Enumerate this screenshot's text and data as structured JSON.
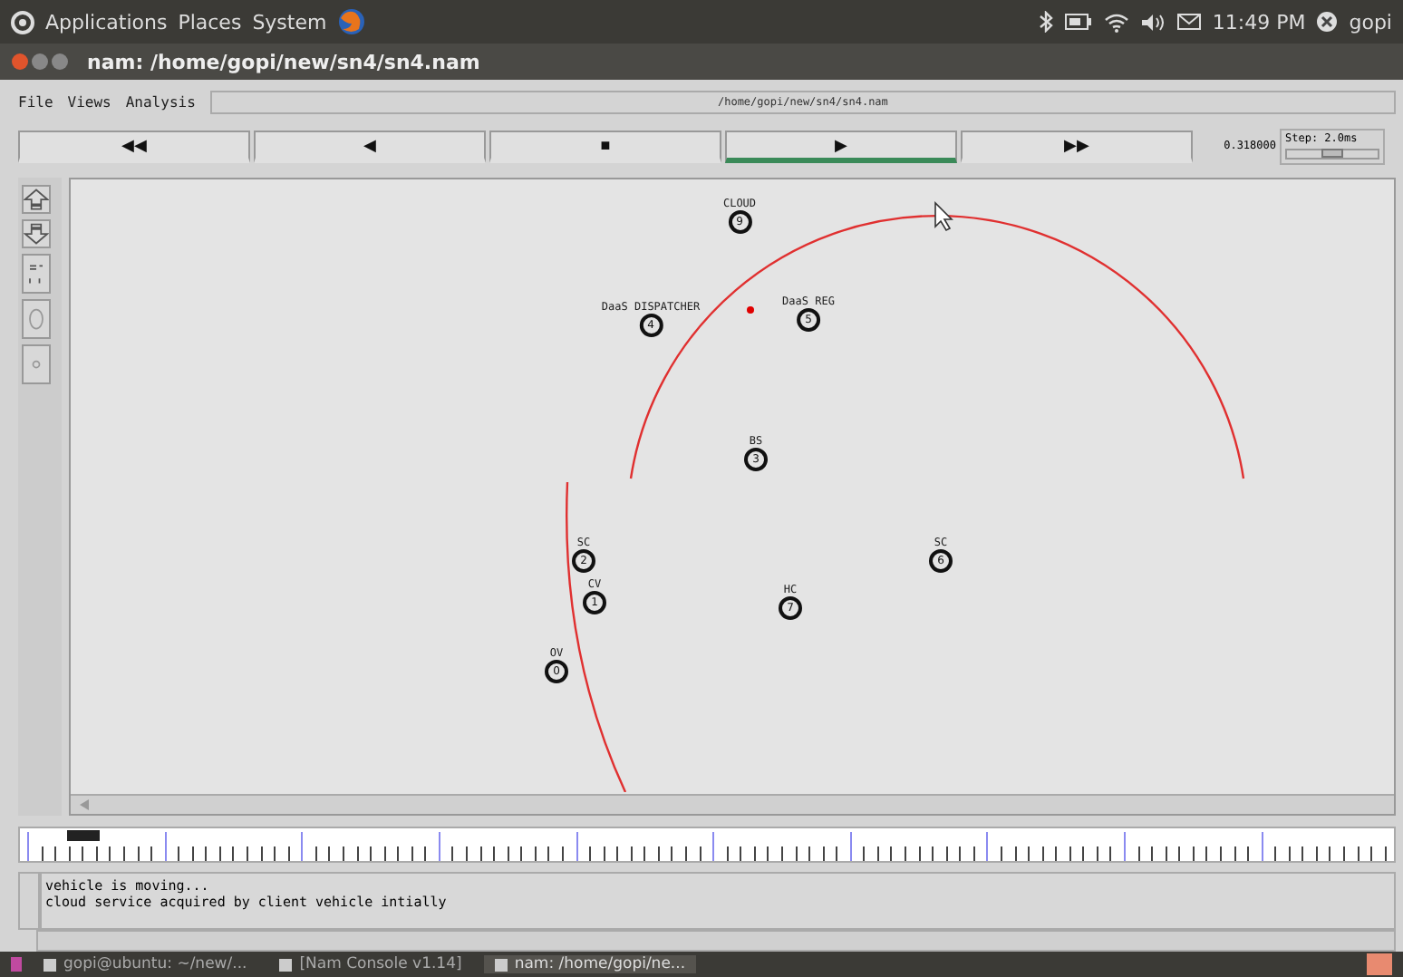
{
  "top_panel": {
    "menus": [
      "Applications",
      "Places",
      "System"
    ],
    "clock": "11:49 PM",
    "user": "gopi"
  },
  "window": {
    "title": "nam: /home/gopi/new/sn4/sn4.nam"
  },
  "menu": [
    "File",
    "Views",
    "Analysis"
  ],
  "file_path": "/home/gopi/new/sn4/sn4.nam",
  "controls": [
    {
      "glyph": "◀◀",
      "selected": false
    },
    {
      "glyph": "◀",
      "selected": false
    },
    {
      "glyph": "■",
      "selected": false
    },
    {
      "glyph": "▶",
      "selected": true
    },
    {
      "glyph": "▶▶",
      "selected": false
    }
  ],
  "time": "0.318000",
  "step": {
    "label": "Step: 2.0ms",
    "level": 0.5
  },
  "nodes": [
    {
      "label": "CLOUD",
      "id": "9"
    },
    {
      "label": "DaaS DISPATCHER",
      "id": "4"
    },
    {
      "label": "DaaS REG",
      "id": "5"
    },
    {
      "label": "BS",
      "id": "3"
    },
    {
      "label": "SC",
      "id": "2"
    },
    {
      "label": "SC",
      "id": "6"
    },
    {
      "label": "CV",
      "id": "1"
    },
    {
      "label": "HC",
      "id": "7"
    },
    {
      "label": "OV",
      "id": "0"
    }
  ],
  "log": [
    "vehicle is moving...",
    "cloud service acquired by client vehicle intially"
  ],
  "taskbar": [
    {
      "label": "gopi@ubuntu: ~/new/...",
      "selected": false
    },
    {
      "label": "[Nam Console v1.14]",
      "selected": false
    },
    {
      "label": "nam: /home/gopi/ne...",
      "selected": true
    }
  ]
}
